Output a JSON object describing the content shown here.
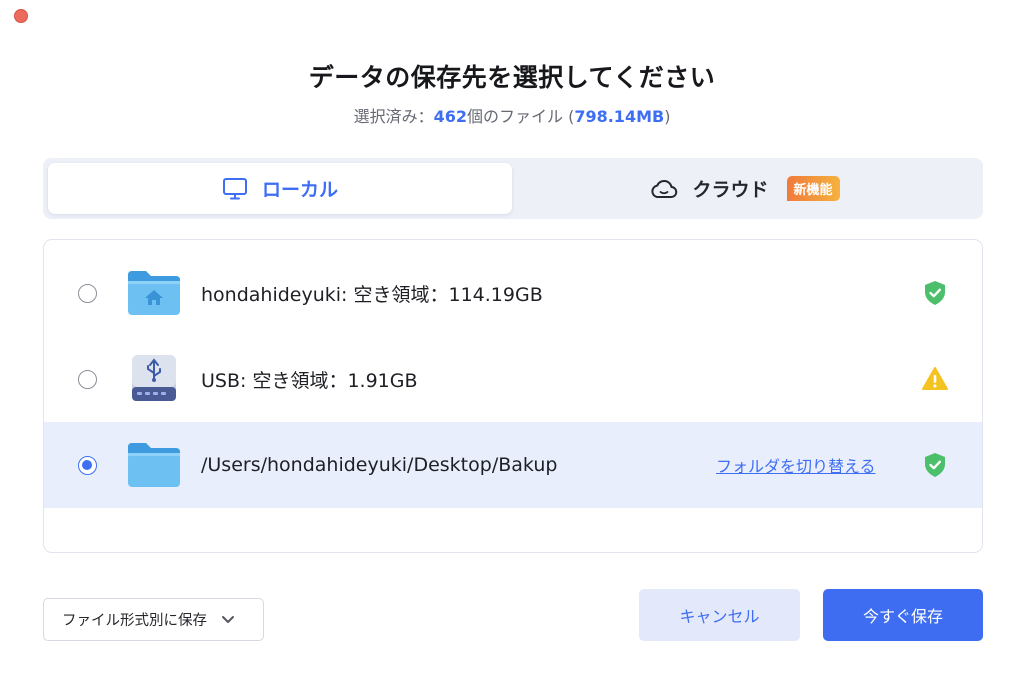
{
  "window": {
    "close_color": "#ec6a5e"
  },
  "header": {
    "title": "データの保存先を選択してください",
    "selected_prefix": "選択済み：",
    "file_count": "462",
    "count_suffix": "個のファイル (",
    "total_size": "798.14MB",
    "size_suffix": ")"
  },
  "tabs": {
    "local_label": "ローカル",
    "cloud_label": "クラウド",
    "cloud_badge": "新機能",
    "active": "local"
  },
  "locations": [
    {
      "label": "hondahideyuki: 空き領域：114.19GB",
      "icon": "home-folder-icon",
      "status": "ok",
      "selected": false
    },
    {
      "label": "USB: 空き領域：1.91GB",
      "icon": "usb-drive-icon",
      "status": "warning",
      "selected": false
    },
    {
      "label": "/Users/hondahideyuki/Desktop/Bakup",
      "icon": "folder-icon",
      "status": "ok",
      "selected": true,
      "link": "フォルダを切り替える"
    }
  ],
  "footer": {
    "format_label": "ファイル形式別に保存",
    "cancel_label": "キャンセル",
    "save_label": "今すぐ保存"
  },
  "colors": {
    "accent": "#3e6ef3",
    "ok": "#4cbf6a",
    "warning": "#f5c320",
    "selected_row": "#e9eefc"
  }
}
